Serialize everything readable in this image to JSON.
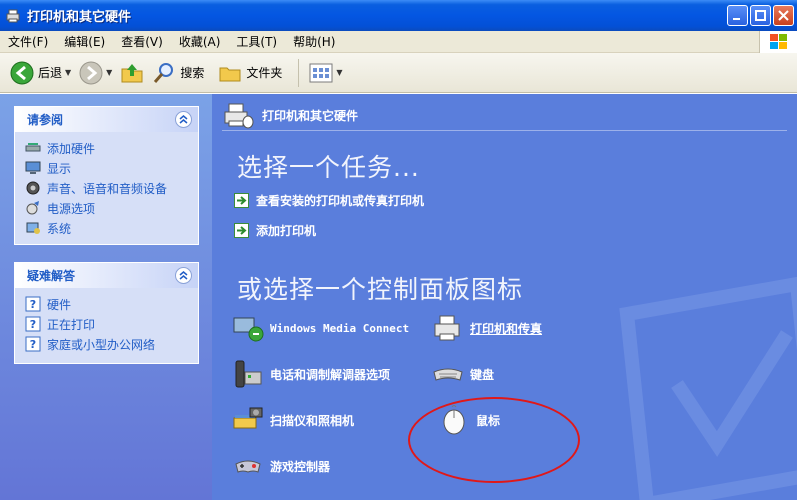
{
  "window": {
    "title": "打印机和其它硬件"
  },
  "menu": {
    "items": [
      "文件(F)",
      "编辑(E)",
      "查看(V)",
      "收藏(A)",
      "工具(T)",
      "帮助(H)"
    ]
  },
  "toolbar": {
    "back": "后退",
    "search": "搜索",
    "folders": "文件夹"
  },
  "see_also": {
    "title": "请参阅",
    "items": [
      "添加硬件",
      "显示",
      "声音、语音和音频设备",
      "电源选项",
      "系统"
    ]
  },
  "troubleshoot": {
    "title": "疑难解答",
    "items": [
      "硬件",
      "正在打印",
      "家庭或小型办公网络"
    ]
  },
  "main": {
    "header": "打印机和其它硬件",
    "task_heading": "选择一个任务...",
    "tasks": [
      "查看安装的打印机或传真打印机",
      "添加打印机"
    ],
    "icon_heading": "或选择一个控制面板图标",
    "icons": [
      "Windows Media Connect",
      "打印机和传真",
      "电话和调制解调器选项",
      "键盘",
      "扫描仪和照相机",
      "鼠标",
      "游戏控制器"
    ]
  },
  "colors": {
    "title_bar": "#0456e2",
    "left_pane": "#6f8fe0",
    "main_pane": "#5a7edc",
    "link": "#215dc6",
    "annotation": "#e01818"
  }
}
